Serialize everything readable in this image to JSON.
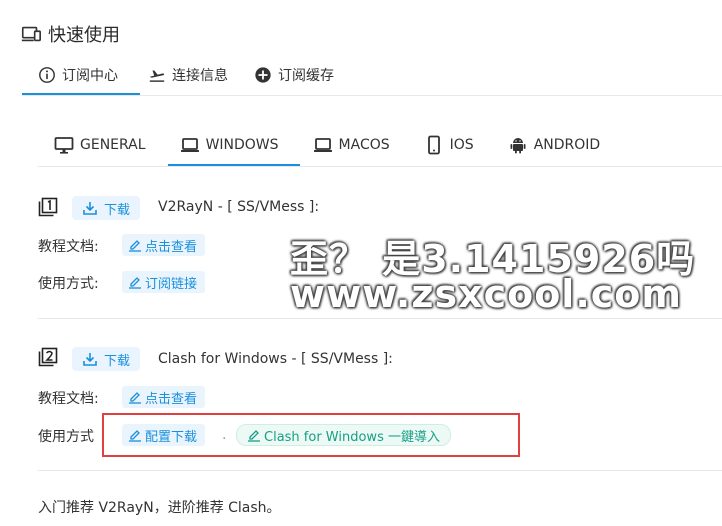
{
  "page": {
    "title": "快速使用"
  },
  "top_tabs": [
    {
      "label": "订阅中心",
      "icon": "info-circle-icon",
      "active": true
    },
    {
      "label": "连接信息",
      "icon": "plane-icon",
      "active": false
    },
    {
      "label": "订阅缓存",
      "icon": "plus-circle-icon",
      "active": false
    }
  ],
  "os_tabs": [
    {
      "label": "GENERAL",
      "icon": "monitor-icon"
    },
    {
      "label": "WINDOWS",
      "icon": "laptop-icon",
      "active": true
    },
    {
      "label": "MACOS",
      "icon": "laptop-icon"
    },
    {
      "label": "IOS",
      "icon": "phone-icon"
    },
    {
      "label": "ANDROID",
      "icon": "android-icon"
    }
  ],
  "clients": [
    {
      "download_label": "下载",
      "title": "V2RayN - [ SS/VMess ]:",
      "doc_label": "教程文档:",
      "doc_button": "点击查看",
      "usage_label": "使用方式:",
      "usage_button": "订阅链接"
    },
    {
      "download_label": "下载",
      "title": "Clash for Windows - [ SS/VMess ]:",
      "doc_label": "教程文档:",
      "doc_button": "点击查看",
      "usage_label": "使用方式",
      "usage_button": "配置下载",
      "usage_dot": ".",
      "import_button": "Clash for Windows 一鍵導入"
    }
  ],
  "footer_note": "入门推荐 V2RayN，进阶推荐 Clash。",
  "watermark": {
    "line1": "歪？ 是3.1415926吗",
    "line2": "www.zsxcool.com"
  },
  "colors": {
    "accent": "#1a8fdc",
    "green": "#16a085",
    "highlight_box": "#e04040"
  }
}
